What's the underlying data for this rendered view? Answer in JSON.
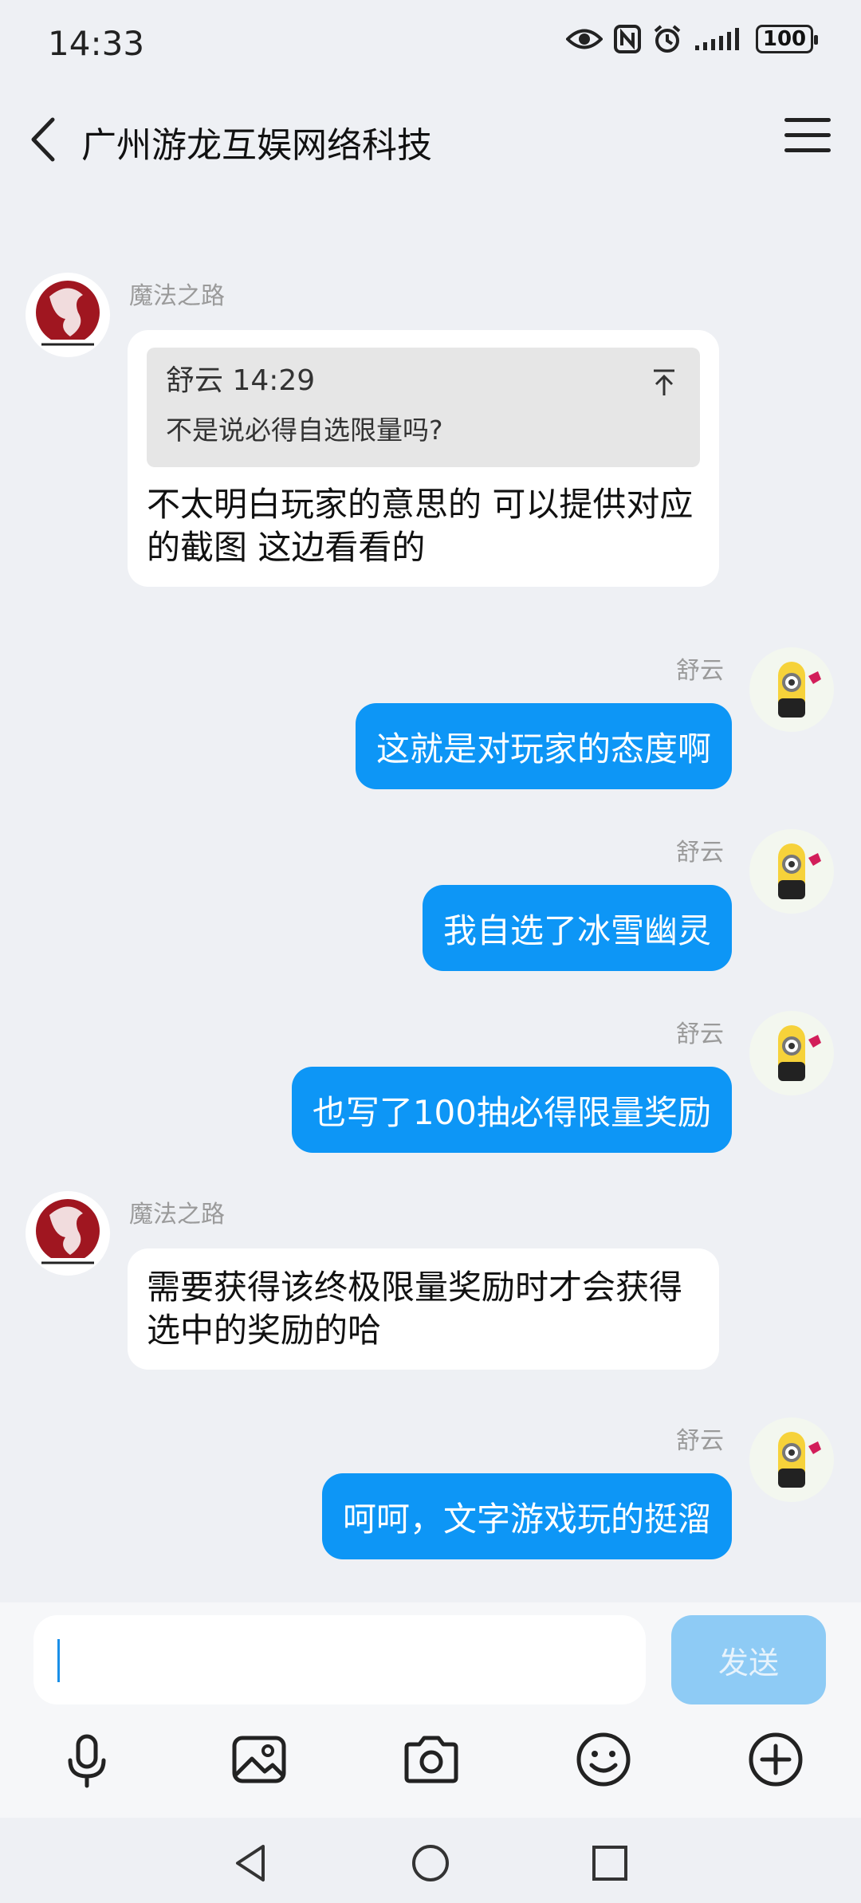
{
  "status": {
    "time": "14:33",
    "battery": "100"
  },
  "header": {
    "title": "广州游龙互娱网络科技"
  },
  "messages": [
    {
      "side": "left",
      "sender": "魔法之路",
      "quote": {
        "meta": "舒云 14:29",
        "text": "不是说必得自选限量吗?"
      },
      "text": "不太明白玩家的意思的 可以提供对应的截图 这边看看的"
    },
    {
      "side": "right",
      "sender": "舒云",
      "text": "这就是对玩家的态度啊"
    },
    {
      "side": "right",
      "sender": "舒云",
      "text": "我自选了冰雪幽灵"
    },
    {
      "side": "right",
      "sender": "舒云",
      "text": "也写了100抽必得限量奖励"
    },
    {
      "side": "left",
      "sender": "魔法之路",
      "text": "需要获得该终极限量奖励时才会获得选中的奖励的哈"
    },
    {
      "side": "right",
      "sender": "舒云",
      "text": "呵呵，文字游戏玩的挺溜"
    }
  ],
  "input": {
    "placeholder": "",
    "send_label": "发送"
  },
  "toolbar": [
    "microphone-icon",
    "image-icon",
    "camera-icon",
    "emoji-icon",
    "plus-icon"
  ],
  "colors": {
    "accent": "#0d96f6",
    "background": "#eef0f4",
    "send_disabled": "#8ecbf5"
  }
}
